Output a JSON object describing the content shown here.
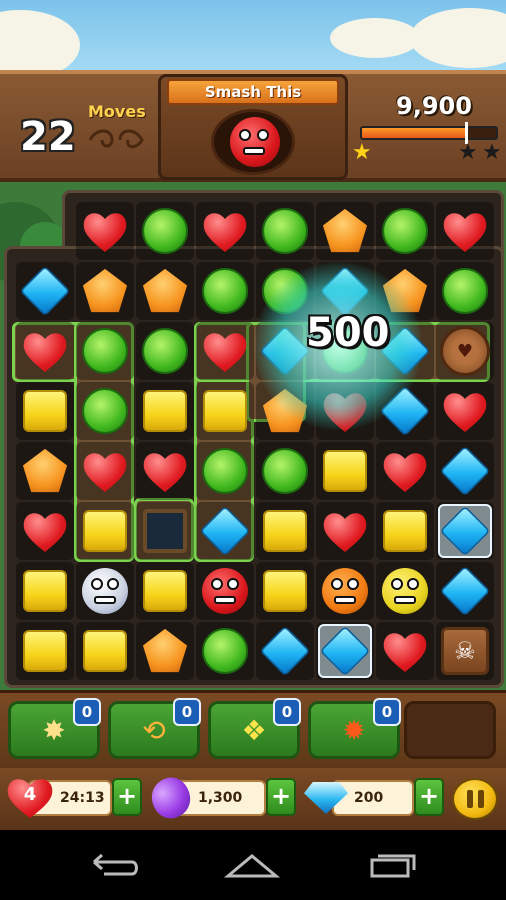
{
  "top_bar": {
    "moves_count": "22",
    "moves_label": "Moves",
    "target_label": "Smash This",
    "score": "9,900",
    "score_progress": 0.78
  },
  "board": {
    "popup_score": "500",
    "rows": [
      [
        "empty",
        "heart",
        "green",
        "heart",
        "green",
        "orange",
        "green",
        "heart"
      ],
      [
        "blue",
        "orange",
        "orange",
        "green",
        "green",
        "blue",
        "orange",
        "green"
      ],
      [
        "heart",
        "green",
        "green",
        "heart",
        "blue",
        "green",
        "blue",
        "barrel"
      ],
      [
        "yellow",
        "green",
        "yellow",
        "yellow",
        "orange",
        "heart",
        "blue",
        "heart"
      ],
      [
        "orange",
        "heart",
        "heart",
        "green",
        "green",
        "yellow",
        "heart",
        "blue"
      ],
      [
        "heart",
        "yellow",
        "hole",
        "blue",
        "yellow",
        "heart",
        "yellow",
        "blue-ice"
      ],
      [
        "yellow",
        "monster-grey",
        "yellow",
        "monster-red",
        "yellow",
        "monster-orange",
        "monster-yellow",
        "blue"
      ],
      [
        "yellow",
        "yellow",
        "orange",
        "green",
        "blue",
        "blue-ice",
        "heart",
        "skull-crate"
      ]
    ]
  },
  "boosters": [
    {
      "name": "hammer-booster",
      "icon": "✸",
      "count": "0"
    },
    {
      "name": "swap-booster",
      "icon": "⟲",
      "count": "0"
    },
    {
      "name": "shuffle-booster",
      "icon": "❖",
      "count": "0"
    },
    {
      "name": "fire-booster",
      "icon": "✹",
      "count": "0"
    }
  ],
  "resources": {
    "lives": "4",
    "lives_timer": "24:13",
    "beans": "1,300",
    "diamonds": "200",
    "plus": "+"
  },
  "colors": {
    "wood": "#7a4a24",
    "green_button": "#3ea52a",
    "count_badge": "#1a5fb5"
  }
}
